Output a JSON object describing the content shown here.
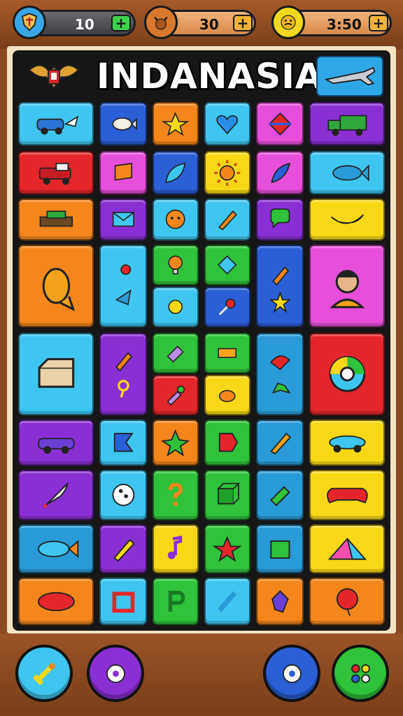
{
  "header": {
    "left_counter": "10",
    "mid_counter": "30",
    "right_counter": "3:50",
    "plus_label": "+"
  },
  "board": {
    "title": "INDANASIA"
  },
  "colors": {
    "cyan": "#3ec6f0",
    "blue": "#2a5fd6",
    "orange": "#f4861c",
    "green": "#2fc23a",
    "magenta": "#e64fd9",
    "purple": "#8a2fd4",
    "red": "#e3262a",
    "yellow": "#f8d816",
    "lime": "#5bd61e",
    "teal": "#2a9bd6",
    "pink": "#f74fb0"
  },
  "tiles": [
    {
      "name": "car-plane-tile",
      "icon": "car-icon",
      "color": "cyan"
    },
    {
      "name": "fish-tile",
      "icon": "fish-icon",
      "color": "blue"
    },
    {
      "name": "star-bug-tile",
      "icon": "bug-icon",
      "color": "orange"
    },
    {
      "name": "heart-tile",
      "icon": "heart-icon",
      "color": "cyan"
    },
    {
      "name": "diamond-tile",
      "icon": "diamond-icon",
      "color": "magenta"
    },
    {
      "name": "truck-tile",
      "icon": "truck-icon",
      "color": "purple"
    },
    {
      "name": "red-truck-tile",
      "icon": "truck-icon",
      "color": "red"
    },
    {
      "name": "flag-tile",
      "icon": "flag-icon",
      "color": "magenta"
    },
    {
      "name": "leaf-tile",
      "icon": "leaf-icon",
      "color": "blue"
    },
    {
      "name": "sun-tile",
      "icon": "sun-icon",
      "color": "yellow"
    },
    {
      "name": "surfboard-tile",
      "icon": "leaf-icon",
      "color": "magenta"
    },
    {
      "name": "fish-tile-2",
      "icon": "fish-icon",
      "color": "cyan"
    },
    {
      "name": "tank-tile",
      "icon": "tank-icon",
      "color": "orange"
    },
    {
      "name": "envelope-tile",
      "icon": "envelope-icon",
      "color": "purple"
    },
    {
      "name": "face-tile",
      "icon": "face-icon",
      "color": "cyan"
    },
    {
      "name": "pencil-tile",
      "icon": "pencil-icon",
      "color": "cyan"
    },
    {
      "name": "speech-tile",
      "icon": "speech-icon",
      "color": "purple"
    },
    {
      "name": "banana-tile",
      "icon": "banana-icon",
      "color": "yellow"
    }
  ],
  "bottom": {
    "left_button": "sword-icon",
    "second_button": "gear-icon",
    "third_button": "gear-icon",
    "right_button": "gamepad-icon"
  }
}
